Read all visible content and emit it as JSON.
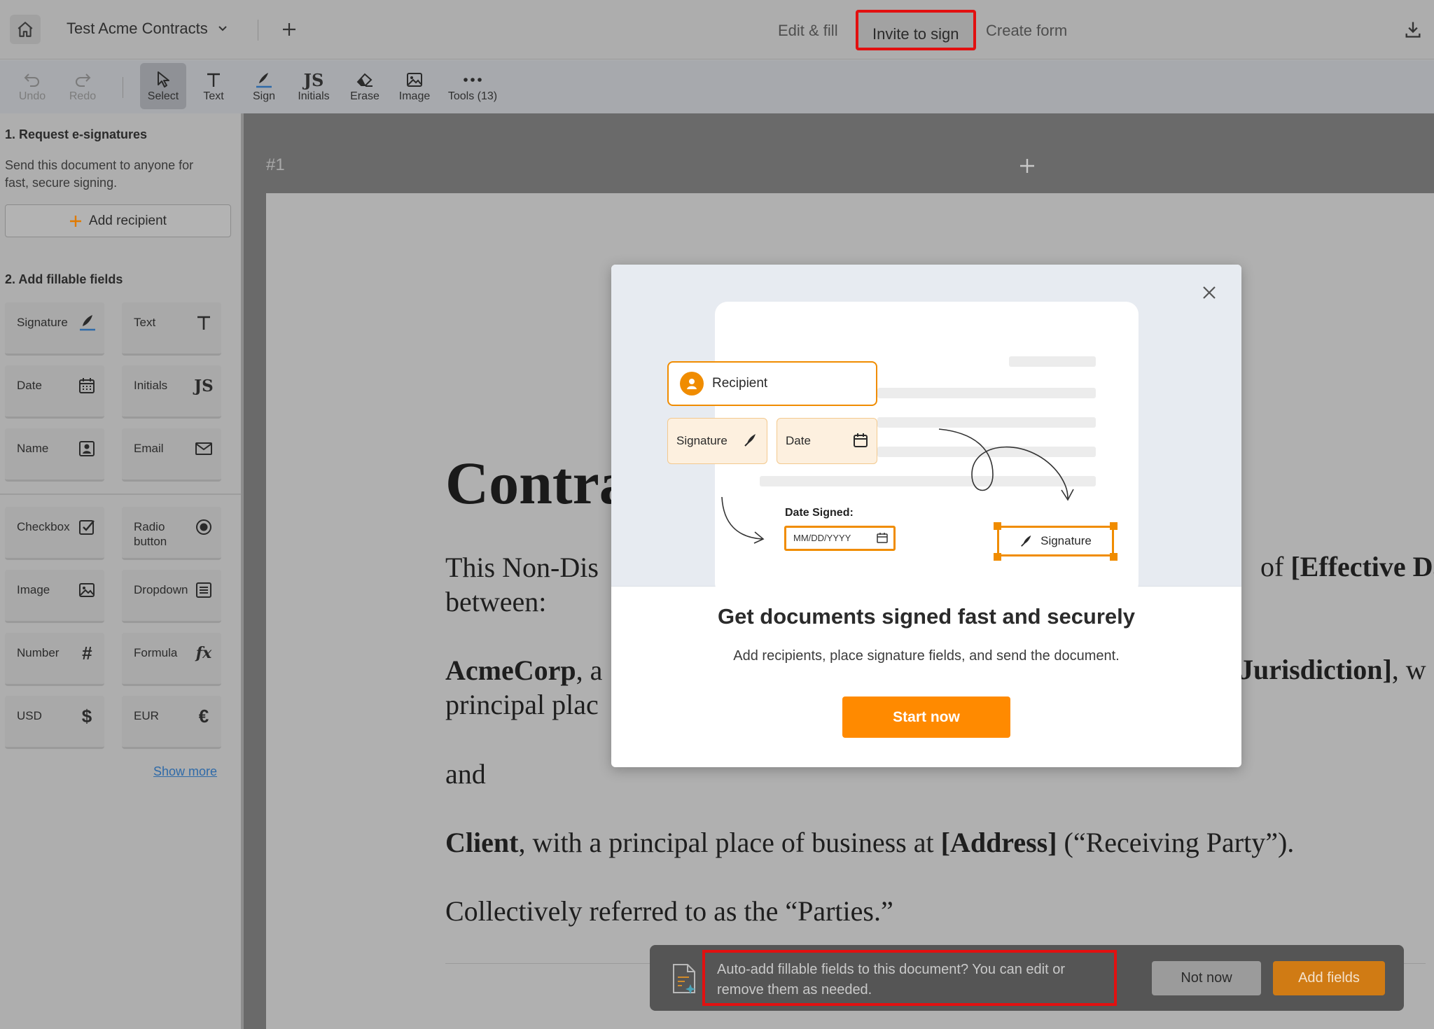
{
  "header": {
    "doc_title": "Test Acme Contracts",
    "tabs": [
      {
        "label": "Edit & fill"
      },
      {
        "label": "Invite to sign"
      },
      {
        "label": "Create form"
      }
    ]
  },
  "toolbar": {
    "tools": [
      {
        "label": "Undo",
        "icon": "undo-icon"
      },
      {
        "label": "Redo",
        "icon": "redo-icon"
      },
      {
        "label": "Select",
        "icon": "cursor-icon"
      },
      {
        "label": "Text",
        "icon": "text-icon"
      },
      {
        "label": "Sign",
        "icon": "sign-icon"
      },
      {
        "label": "Initials",
        "icon": "initials-icon"
      },
      {
        "label": "Erase",
        "icon": "eraser-icon"
      },
      {
        "label": "Image",
        "icon": "image-icon"
      },
      {
        "label": "Tools (13)",
        "icon": "more-icon"
      }
    ]
  },
  "sidebar": {
    "section1_title": "1. Request e-signatures",
    "section1_desc": "Send this document to anyone for fast, secure signing.",
    "add_recipient": "Add recipient",
    "section2_title": "2. Add fillable fields",
    "fields": [
      {
        "label": "Signature",
        "icon": "signature-icon"
      },
      {
        "label": "Text",
        "icon": "text-icon"
      },
      {
        "label": "Date",
        "icon": "calendar-icon"
      },
      {
        "label": "Initials",
        "icon": "initials-icon"
      },
      {
        "label": "Name",
        "icon": "name-icon"
      },
      {
        "label": "Email",
        "icon": "email-icon"
      },
      {
        "label": "Checkbox",
        "icon": "checkbox-icon"
      },
      {
        "label": "Radio button",
        "icon": "radio-icon"
      },
      {
        "label": "Image",
        "icon": "image-icon"
      },
      {
        "label": "Dropdown",
        "icon": "dropdown-icon"
      },
      {
        "label": "Number",
        "icon": "hash-icon"
      },
      {
        "label": "Formula",
        "icon": "formula-icon"
      },
      {
        "label": "USD",
        "icon": "dollar-icon"
      },
      {
        "label": "EUR",
        "icon": "euro-icon"
      }
    ],
    "show_more": "Show more"
  },
  "page": {
    "number": "#1",
    "heading": "Contra",
    "para1_line1_start": "This Non-Dis",
    "para1_line1_end_prefix": "of ",
    "para1_line1_end_bold": "[Effective Da",
    "para1_line2": "between:",
    "para2_bold": "AcmeCorp",
    "para2_rest": ", a",
    "para2_right_bold": "Jurisdiction]",
    "para2_right_rest": ", w",
    "para2_line2": "principal plac",
    "para3": "and",
    "para4_bold": "Client",
    "para4_rest": ", with a principal place of business at ",
    "para4_bold2": "[Address]",
    "para4_rest2": " (“Receiving Party”).",
    "para5": "Collectively referred to as the “Parties.”"
  },
  "modal": {
    "illustration": {
      "recipient": "Recipient",
      "signature": "Signature",
      "date": "Date",
      "date_signed_label": "Date Signed:",
      "date_placeholder": "MM/DD/YYYY",
      "signature_box": "Signature"
    },
    "title": "Get documents signed fast and securely",
    "subtitle": "Add recipients, place signature fields, and send the document.",
    "cta": "Start now"
  },
  "notification": {
    "message": "Auto-add fillable fields to this document? You can edit or remove them as needed.",
    "not_now": "Not now",
    "add_fields": "Add fields"
  },
  "colors": {
    "accent": "#ff8a00",
    "highlight": "#e21010"
  }
}
